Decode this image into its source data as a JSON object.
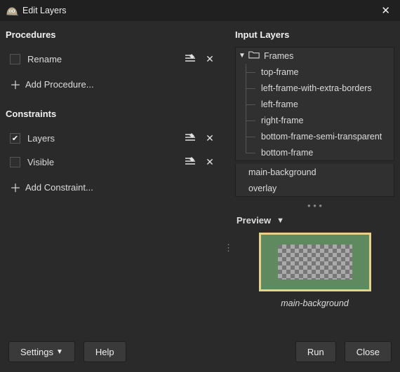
{
  "window": {
    "title": "Edit Layers"
  },
  "left": {
    "procedures": {
      "heading": "Procedures",
      "items": [
        {
          "label": "Rename",
          "checked": false
        }
      ],
      "add_label": "Add Procedure..."
    },
    "constraints": {
      "heading": "Constraints",
      "items": [
        {
          "label": "Layers",
          "checked": true
        },
        {
          "label": "Visible",
          "checked": false
        }
      ],
      "add_label": "Add Constraint..."
    }
  },
  "right": {
    "input_heading": "Input Layers",
    "folder": {
      "name": "Frames",
      "children": [
        "top-frame",
        "left-frame-with-extra-borders",
        "left-frame",
        "right-frame",
        "bottom-frame-semi-transparent",
        "bottom-frame"
      ]
    },
    "flat_layers": [
      "main-background",
      "overlay"
    ],
    "preview": {
      "heading": "Preview",
      "caption": "main-background"
    }
  },
  "footer": {
    "settings": "Settings",
    "help": "Help",
    "run": "Run",
    "close": "Close"
  }
}
